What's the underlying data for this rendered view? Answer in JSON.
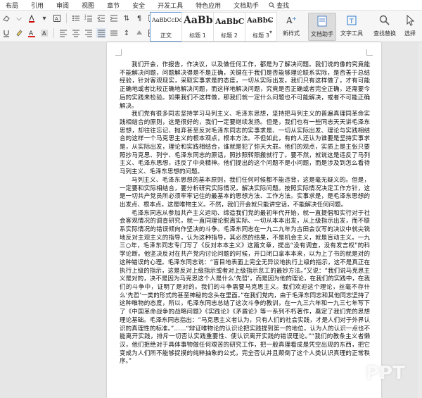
{
  "menu": {
    "items": [
      "布局",
      "引用",
      "审阅",
      "视图",
      "章节",
      "安全",
      "开发工具",
      "特色应用",
      "文档助手"
    ],
    "search_label": "查找"
  },
  "ribbon": {
    "styles": [
      {
        "sample": "AaBbCcDd",
        "name": "正文"
      },
      {
        "sample": "AaBb",
        "name": "标题 1"
      },
      {
        "sample": "AaBbC",
        "name": "标题 2"
      },
      {
        "sample": "AaBbC",
        "name": "标题 3"
      }
    ],
    "new_style_label": "新样式",
    "doc_assistant_label": "文档助手",
    "text_tools_label": "文字工具",
    "find_replace_label": "查找替换",
    "select_label": "选择"
  },
  "document": {
    "paragraphs": [
      "我们开会，作报告，作决议，以及做任何工作，都是为了解决问题。我们说的像的究竟能不能解决问题，问题解决得是不是正确，关键在于我们是否能够理论联系实际，是否善于总结经验，针对客观现实，采取实事求是的态度，一切从实际出发。我们只有这样做了，才有可能正确地或者比较正确地解决问题，而这样地解决问题，究竟是否正确或者完全正确，还需要今后的实践来检验。如果我们不这样做，那我们就一定什么问题也不可能解决，或者不可能正确解决。",
      "我们党有很多同志坚持学习马列主义、毛泽东思想，坚持把马列主义的普遍真理同革命实践相结合的原则，这是很好的，我们一定要继续发扬。但是，我们也有一些同志天天讲毛泽东思想，却往往忘记、抛弃甚至反对毛泽东同志的实事求是、一切从实际出发、理论与实践相结合的这样一个马克思主义的根本观点，根本方法。不但如此，有的人还认为谁要是坚持实事求是，从实际出发，理论和实践相结合，谁就是犯了弥天大罪。他们的观点，实质上是主张只要照抄马克思、列宁、毛泽东同志的原话，照抄照转照搬就行了。要不然，就说这是违反了马列主义、毛泽东思想，违反了中央精神。他们提出的这个问题不是小问题，而是涉及到怎么看待马列主义、毛泽东思想的问题。",
      "马列主义、毛泽东思想的基本原则，我们任何时候都不能违背，这是毫无疑义的。但是，一定要和实际相结合，要分析研究实际情况，解决实际问题。按照实际情况决定工作方针，这是一切共产党员所必须牢牢记住的最基本的思想方法、工作方法。实事求是，是毛泽东思想的出发点、根本点。这是唯物主义。不然，我们开会就只能讲空话，不能解决任何问题。",
      "毛泽东同志从参加共产主义运动、缔造我们党的最初年代开始，就一直提倡和实行对于社会客观情况的调查研究，就一直同理论脱离实际、一切从本本出发，从上级指示出发，而不联系实际情况的错误倾向作坚决的斗争。毛泽东同志在一九二九年为古田会议写的决议中就尖锐地反对主观主义的指导，认为这种指导，其必然的结果，不是机会主义，就是盲动主义。一九三○年，毛泽东同志专门写了《反对本本主义》这篇文章，提出“没有调查，没有发言权”的科学论断。他坚决反对在共产党内讨论问题的时候，开口闭口拿本本来，以为上了书的就是对的这种错误的心理。毛泽东同志说：“盲目地表面上完全无异议地执行上级的指示，这不是真正在执行上级的指示，这是反对上级指示或者对上级指示怠工的最妙方法。”又说：“我们说马克思主义是对的，决不是因为马克思这个人是什么‘先哲’，而是因为他的理论，在我们的实践中，在我们的斗争中，证明了是对的。我们的斗争需要马克思主义。我们欢迎这个理论，丝毫不存什么‘先哲’一类的形式的甚至神秘的念头在里面。”在我们党内，由于毛泽东同志和其他同志坚持了这种唯物的态度，所以，毛泽东同志总结了这次斗争的教训，在一九三六年和一九三七年写下了《中国革命战争的战略问题》《实践论》《矛盾论》等一系列不朽著作，奠定了我们党的思想理论基础。毛泽东同志指出：“马克思主义者认为，只有人们的社会实践，才是人们对于外界认识的真理性的标准。”……“辩证唯物论的认识论把实践提到第一的地位，认为人的认识一点也不能离开实践，排斥一切否认实践重要性、使认识离开实践的错误理论。”“我们的教条主义者懒汉，他们拒绝对于具体事物做任何艰苦的研究工作，把一般真理看成是凭空出现的东西，把它变成为人们所不能够捉摸的纯粹抽象的公式，完全否认并且颠倒了这个人类认识真理的正常秩序。”"
    ]
  },
  "watermark": "PPT"
}
